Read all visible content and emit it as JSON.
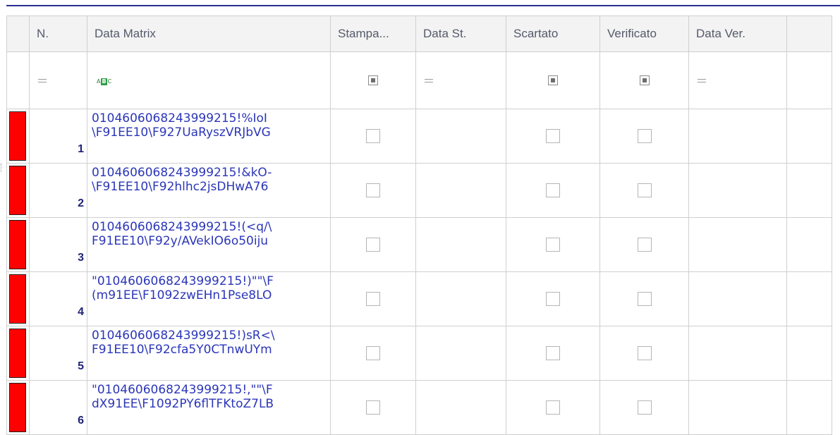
{
  "columns": [
    "N.",
    "Data Matrix",
    "Stampa...",
    "Data St.",
    "Scartato",
    "Verificato",
    "Data Ver."
  ],
  "filter_row": {
    "n": "equals-filter-icon",
    "data_matrix": "text-filter-icon",
    "text_filter_letters": [
      "A",
      "B",
      "C"
    ],
    "stampa": "checkbox-filter-indeterminate",
    "data_st": "equals-filter-icon",
    "scartato": "checkbox-filter-indeterminate",
    "verificato": "checkbox-filter-indeterminate",
    "data_ver": "equals-filter-icon"
  },
  "row_flag_color": "#ff0000",
  "rows": [
    {
      "n": "1",
      "dm_line1": "0104606068243999215!%IoI",
      "dm_line2": "\\F91EE10\\F927UaRyszVRJbVG",
      "stampa": false,
      "data_st": "",
      "scartato": false,
      "verificato": false,
      "data_ver": ""
    },
    {
      "n": "2",
      "dm_line1": "0104606068243999215!&kO-",
      "dm_line2": "\\F91EE10\\F92hlhc2jsDHwA76",
      "stampa": false,
      "data_st": "",
      "scartato": false,
      "verificato": false,
      "data_ver": ""
    },
    {
      "n": "3",
      "dm_line1": "0104606068243999215!(<q/\\",
      "dm_line2": "F91EE10\\F92y/AVekIO6o50iju",
      "stampa": false,
      "data_st": "",
      "scartato": false,
      "verificato": false,
      "data_ver": ""
    },
    {
      "n": "4",
      "dm_line1": "\"0104606068243999215!)\"\"\\F",
      "dm_line2": "(m91EE\\F1092zwEHn1Pse8LO",
      "stampa": false,
      "data_st": "",
      "scartato": false,
      "verificato": false,
      "data_ver": ""
    },
    {
      "n": "5",
      "dm_line1": "0104606068243999215!)sR<\\",
      "dm_line2": "F91EE10\\F92cfa5Y0CTnwUYm",
      "stampa": false,
      "data_st": "",
      "scartato": false,
      "verificato": false,
      "data_ver": ""
    },
    {
      "n": "6",
      "dm_line1": "\"0104606068243999215!,\"\"\\F",
      "dm_line2": "dX91EE\\F1092PY6flTFKtoZ7LB",
      "stampa": false,
      "data_st": "",
      "scartato": false,
      "verificato": false,
      "data_ver": ""
    }
  ]
}
